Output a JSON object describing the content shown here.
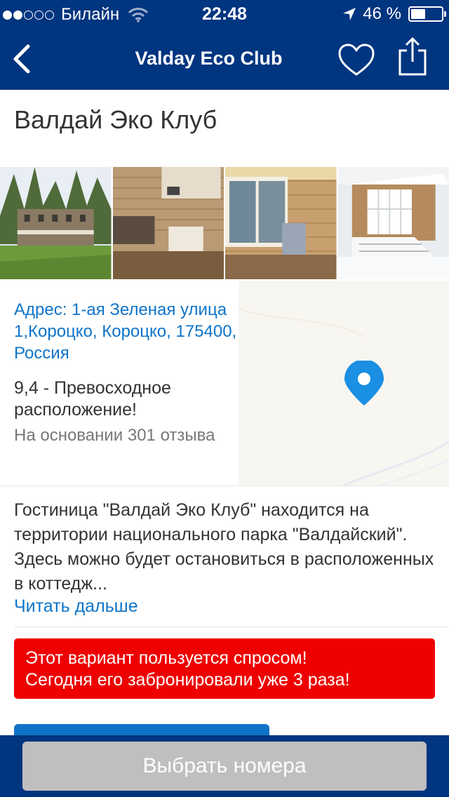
{
  "status_bar": {
    "carrier": "Билайн",
    "time": "22:48",
    "battery": "46 %",
    "signal_bars_filled": 2,
    "signal_bars_total": 5
  },
  "nav": {
    "title": "Valday Eco Club",
    "back_icon": "chevron-left-icon",
    "favorite_icon": "heart-icon",
    "share_icon": "share-icon"
  },
  "hotel": {
    "name": "Валдай Эко Клуб"
  },
  "gallery": {
    "photos": [
      {
        "subject": "hotel exterior in forest"
      },
      {
        "subject": "cottage living room with kitchen"
      },
      {
        "subject": "log room with window and armchair"
      },
      {
        "subject": "cottage porch in winter"
      }
    ]
  },
  "location": {
    "address": "Адрес: 1-ая Зеленая улица 1,Короцко, Короцко, 175400, Россия",
    "score_text": "9,4 - Превосходное расположение!",
    "reviews_text": "На основании 301 отзыва",
    "pin_icon": "map-pin-icon"
  },
  "description": {
    "text": "Гостиница \"Валдай Эко Клуб\" находится на территории национального парка \"Валдайский\". Здесь можно будет остановиться в расположенных в коттедж...",
    "read_more": "Читать дальше"
  },
  "urgency": {
    "line1": "Этот вариант пользуется спросом!",
    "line2": "Сегодня его забронировали уже 3 раза!"
  },
  "bottom": {
    "select_button": "Выбрать номера"
  },
  "colors": {
    "brand": "#003580",
    "link": "#0f74c8",
    "alert": "#ee0000",
    "disabled_button": "#bfbfbf"
  }
}
